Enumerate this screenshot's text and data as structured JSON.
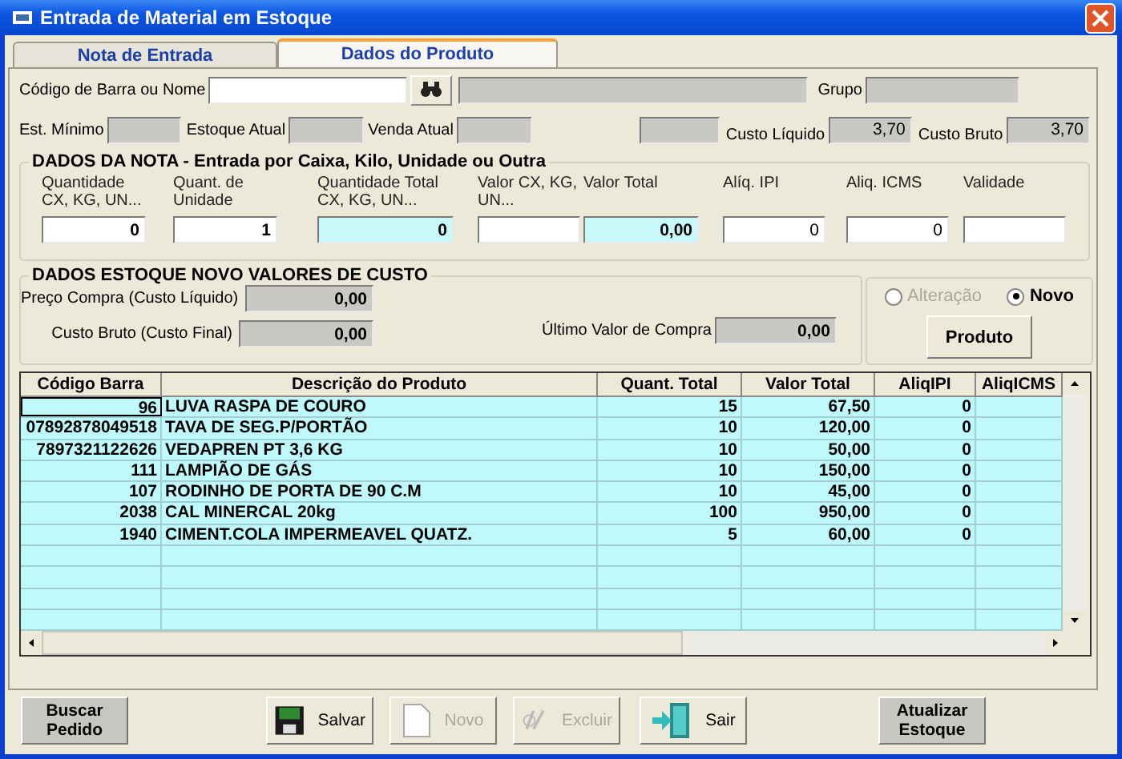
{
  "window": {
    "title": "Entrada de Material em Estoque"
  },
  "tabs": [
    {
      "label": "Nota de Entrada",
      "selected": false
    },
    {
      "label": "Dados do Produto",
      "selected": true
    }
  ],
  "search": {
    "label": "Código de Barra ou Nome"
  },
  "group": {
    "label": "Grupo"
  },
  "stock": [
    {
      "label": "Est. Mínimo"
    },
    {
      "label": "Estoque Atual"
    },
    {
      "label": "Venda Atual"
    }
  ],
  "costs": [
    {
      "label": "Custo Líquido",
      "value": "3,70"
    },
    {
      "label": "Custo Bruto",
      "value": "3,70"
    }
  ],
  "nota": {
    "title": "DADOS DA NOTA - Entrada por Caixa, Kilo, Unidade ou Outra",
    "fields": [
      {
        "label": "Quantidade  CX, KG, UN...",
        "kind": "input",
        "value": "0",
        "bold": true
      },
      {
        "label": "Quant. de Unidade",
        "kind": "input",
        "value": "1",
        "bold": true
      },
      {
        "label": "Quantidade Total CX, KG, UN...",
        "kind": "computed",
        "value": "0",
        "bold": true
      },
      {
        "label": "Valor CX, KG, UN...",
        "kind": "input"
      },
      {
        "label": "Valor Total",
        "kind": "computed",
        "value": "0,00",
        "bold": true
      },
      {
        "label": "Alíq. IPI",
        "kind": "input",
        "value": "0",
        "bold": false
      },
      {
        "label": "Aliq. ICMS",
        "kind": "input",
        "value": "0",
        "bold": false
      },
      {
        "label": "Validade",
        "kind": "input"
      }
    ]
  },
  "estoque": {
    "title": "DADOS ESTOQUE NOVO VALORES DE CUSTO",
    "fields": [
      {
        "label": "Preço Compra (Custo Líquido)",
        "value": "0,00"
      },
      {
        "label": "Custo Bruto (Custo Final)",
        "value": "0,00"
      }
    ],
    "last": {
      "label": "Último Valor de Compra",
      "value": "0,00"
    }
  },
  "mode": {
    "options": [
      {
        "label": "Alteração",
        "selected": false,
        "disabled": true
      },
      {
        "label": "Novo",
        "selected": true,
        "disabled": false
      }
    ],
    "button": "Produto"
  },
  "table": {
    "columns": [
      "Código Barra",
      "Descrição do Produto",
      "Quant. Total",
      "Valor Total",
      "AliqIPI",
      "AliqICMS"
    ],
    "rows": [
      {
        "cells": [
          "96",
          "LUVA RASPA DE COURO",
          "15",
          "67,50",
          "0"
        ],
        "selected": true
      },
      {
        "cells": [
          "07892878049518",
          "TAVA DE SEG.P/PORTÃO",
          "10",
          "120,00",
          "0"
        ],
        "selected": false
      },
      {
        "cells": [
          "7897321122626",
          "VEDAPREN PT 3,6 KG",
          "10",
          "50,00",
          "0"
        ],
        "selected": false
      },
      {
        "cells": [
          "111",
          "LAMPIÃO DE  GÁS",
          "10",
          "150,00",
          "0"
        ],
        "selected": false
      },
      {
        "cells": [
          "107",
          "RODINHO DE PORTA DE 90 C.M",
          "10",
          "45,00",
          "0"
        ],
        "selected": false
      },
      {
        "cells": [
          "2038",
          "CAL MINERCAL 20kg",
          "100",
          "950,00",
          "0"
        ],
        "selected": false
      },
      {
        "cells": [
          "1940",
          "CIMENT.COLA IMPERMEAVEL  QUATZ.",
          "5",
          "60,00",
          "0"
        ],
        "selected": false
      }
    ]
  },
  "buttons": [
    {
      "label": "Buscar Pedido",
      "kind": "action",
      "disabled": false
    },
    {
      "label": "Salvar",
      "kind": "save",
      "disabled": false
    },
    {
      "label": "Novo",
      "kind": "new",
      "disabled": true
    },
    {
      "label": "Excluir",
      "kind": "delete",
      "disabled": true
    },
    {
      "label": "Sair",
      "kind": "exit",
      "disabled": false
    },
    {
      "label": "Atualizar Estoque",
      "kind": "action",
      "disabled": false
    }
  ]
}
